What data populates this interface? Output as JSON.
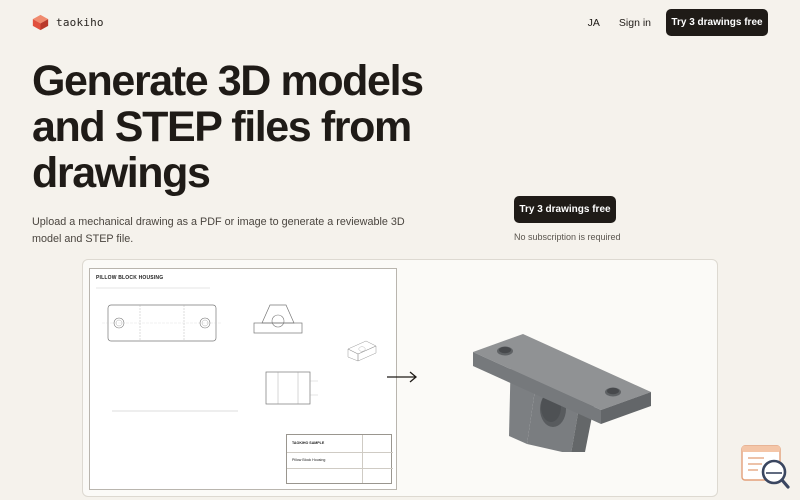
{
  "header": {
    "brand": "taokiho",
    "nav": {
      "lang": "JA",
      "signin": "Sign in"
    },
    "cta_label": "Try 3 drawings free"
  },
  "hero": {
    "headline": "Generate 3D models and STEP files from drawings",
    "subtext": "Upload a mechanical drawing as a PDF or image to generate a reviewable 3D model and STEP file.",
    "cta_label": "Try 3 drawings free",
    "cta_note": "No subscription is required"
  },
  "preview": {
    "drawing": {
      "title": "PILLOW BLOCK HOUSING",
      "title_block": {
        "sample": "TAOKIHO SAMPLE",
        "part_name": "Pillow Block Housing"
      }
    }
  },
  "colors": {
    "background": "#f5f2ec",
    "primary": "#1f1b17",
    "brand": "#e1503d",
    "model_top": "#8e9092",
    "model_side": "#6f7274"
  },
  "icons": {
    "logo": "cube-logo-icon",
    "arrow": "arrow-right-icon",
    "chat": "chat-search-icon"
  }
}
